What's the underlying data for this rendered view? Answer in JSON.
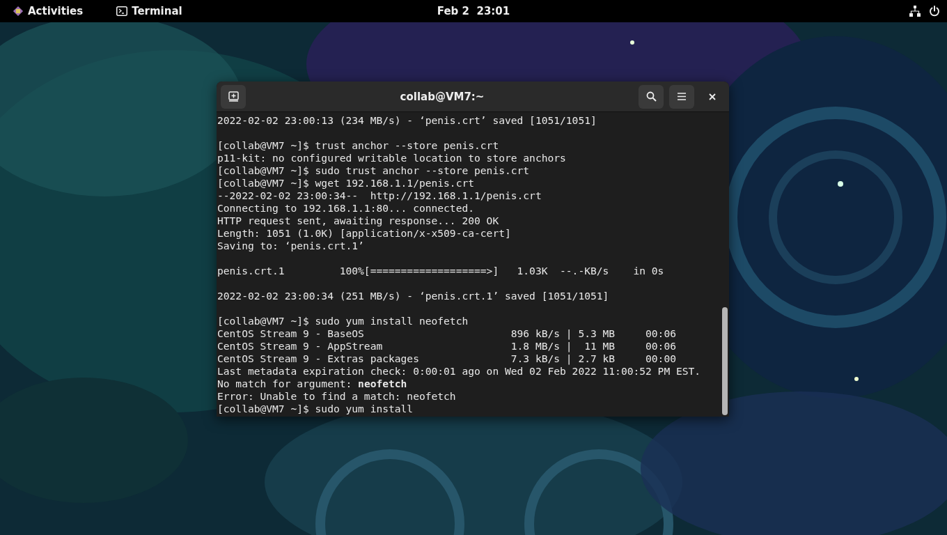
{
  "top_bar": {
    "activities": "Activities",
    "app_menu": "Terminal",
    "clock": "Feb 2  23:01"
  },
  "terminal": {
    "title": "collab@VM7:~",
    "output_blocks": [
      {
        "lines": [
          "2022-02-02 23:00:13 (234 MB/s) - ‘penis.crt’ saved [1051/1051]"
        ]
      },
      {
        "lines": [
          "[collab@VM7 ~]$ trust anchor --store penis.crt",
          "p11-kit: no configured writable location to store anchors",
          "[collab@VM7 ~]$ sudo trust anchor --store penis.crt",
          "[collab@VM7 ~]$ wget 192.168.1.1/penis.crt",
          "--2022-02-02 23:00:34--  http://192.168.1.1/penis.crt",
          "Connecting to 192.168.1.1:80... connected.",
          "HTTP request sent, awaiting response... 200 OK",
          "Length: 1051 (1.0K) [application/x-x509-ca-cert]",
          "Saving to: ‘penis.crt.1’"
        ]
      },
      {
        "lines": [
          "penis.crt.1         100%[===================>]   1.03K  --.-KB/s    in 0s"
        ]
      },
      {
        "lines": [
          "2022-02-02 23:00:34 (251 MB/s) - ‘penis.crt.1’ saved [1051/1051]"
        ]
      },
      {
        "lines": [
          "[collab@VM7 ~]$ sudo yum install neofetch",
          "CentOS Stream 9 - BaseOS                        896 kB/s | 5.3 MB     00:06",
          "CentOS Stream 9 - AppStream                     1.8 MB/s |  11 MB     00:06",
          "CentOS Stream 9 - Extras packages               7.3 kB/s | 2.7 kB     00:00",
          "Last metadata expiration check: 0:00:01 ago on Wed 02 Feb 2022 11:00:52 PM EST.",
          "No match for argument: **neofetch**",
          "Error: Unable to find a match: neofetch",
          "[collab@VM7 ~]$ sudo yum install"
        ]
      }
    ]
  }
}
